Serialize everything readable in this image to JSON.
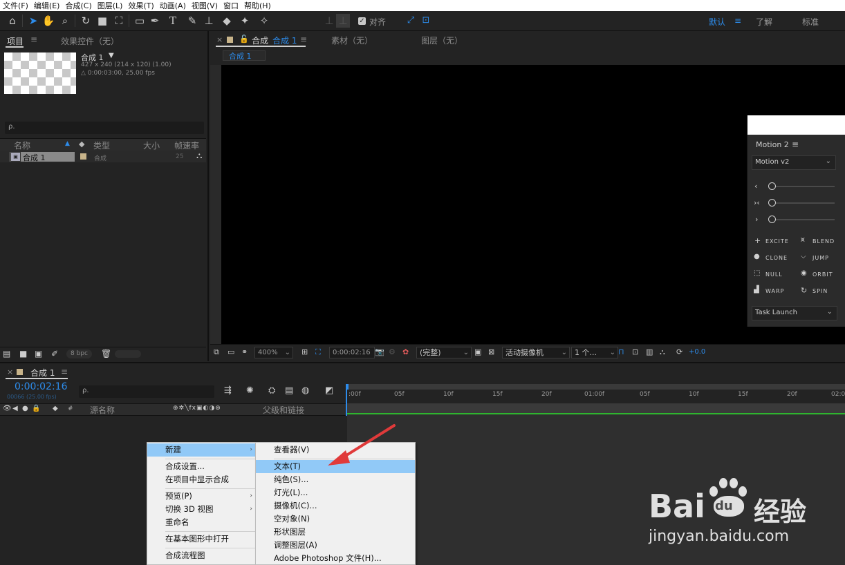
{
  "menubar": {
    "items": [
      "文件(F)",
      "编辑(E)",
      "合成(C)",
      "图层(L)",
      "效果(T)",
      "动画(A)",
      "视图(V)",
      "窗口",
      "帮助(H)"
    ]
  },
  "toolbar": {
    "align_label": "对齐",
    "workspaces": [
      "默认",
      "了解",
      "标准"
    ],
    "workspace_menu_icon": "≡"
  },
  "project_panel": {
    "tab_project": "项目",
    "tab_effects": "效果控件（无）",
    "comp_name": "合成 1",
    "comp_info_line1": "427 x 240  (214 x 120) (1.00)",
    "comp_info_line2": "△ 0:00:03:00, 25.00 fps",
    "search_placeholder": "ρ.",
    "columns": [
      "名称",
      "类型",
      "大小",
      "帧速率"
    ],
    "items": [
      {
        "name": "合成 1",
        "type": "合成",
        "fps": "25"
      }
    ],
    "bpc": "8 bpc"
  },
  "viewer": {
    "tab_comp_prefix": "合成",
    "tab_comp_name": "合成 1",
    "tab_footage": "素材（无）",
    "tab_layer": "图层（无）",
    "breadcrumb": "合成 1",
    "zoom": "400%",
    "timecode": "0:00:02:16",
    "resolution": "(完整)",
    "camera": "活动摄像机",
    "views": "1 个...",
    "exposure": "+0.0"
  },
  "motion_panel": {
    "title": "Motion 2",
    "dropdown": "Motion v2",
    "buttons": [
      "EXCITE",
      "BLEND",
      "CLONE",
      "JUMP",
      "NULL",
      "ORBIT",
      "WARP",
      "SPIN"
    ],
    "task": "Task Launch",
    "slider_labels": [
      "‹",
      "›‹",
      "›"
    ]
  },
  "timeline": {
    "tab_name": "合成 1",
    "timecode": "0:00:02:16",
    "frame_info": "00066 (25.00 fps)",
    "search_placeholder": "ρ.",
    "col_source": "源名称",
    "col_parent": "父级和链接",
    "ruler_ticks": [
      ":00f",
      "05f",
      "10f",
      "15f",
      "20f",
      "01:00f",
      "05f",
      "10f",
      "15f",
      "20f",
      "02:0"
    ]
  },
  "context_menu": {
    "items": [
      "新建",
      "合成设置...",
      "在项目中显示合成",
      "预览(P)",
      "切换 3D 视图",
      "重命名",
      "在基本图形中打开",
      "合成流程图"
    ]
  },
  "submenu": {
    "items": [
      "查看器(V)",
      "文本(T)",
      "纯色(S)...",
      "灯光(L)...",
      "摄像机(C)...",
      "空对象(N)",
      "形状图层",
      "调整图层(A)",
      "Adobe Photoshop 文件(H)..."
    ]
  },
  "watermark": {
    "brand_a": "Bai",
    "brand_b": "du",
    "brand_cn": "经验",
    "url": "jingyan.baidu.com"
  },
  "colors": {
    "accent": "#2d8ceb",
    "menu_highlight": "#91c9f7",
    "arrow": "#e03a3a",
    "timeline_green": "#2fb52f"
  }
}
